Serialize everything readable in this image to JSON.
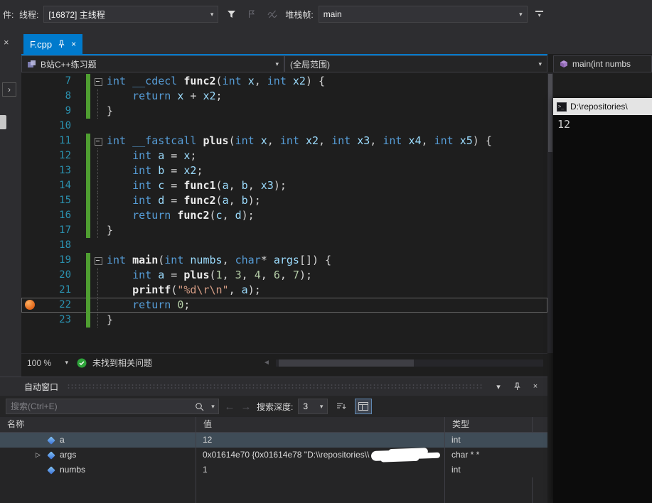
{
  "toolbar": {
    "partial": "件:",
    "thread_label": "线程:",
    "thread_value": "[16872] 主线程",
    "stack_label": "堆栈帧:",
    "stack_value": "main"
  },
  "tab": {
    "title": "F.cpp"
  },
  "navbar": {
    "project": "B站C++练习题",
    "scope": "(全局范围)",
    "member": "main(int numbs"
  },
  "editor": {
    "zoom": "100 %",
    "status_message": "未找到相关问题",
    "lines": [
      {
        "n": "7",
        "fold": "o",
        "chg": true,
        "seg": [
          [
            "k",
            "int "
          ],
          [
            "k",
            "__cdecl "
          ],
          [
            "f",
            "func2"
          ],
          [
            "p",
            "("
          ],
          [
            "k",
            "int "
          ],
          [
            "v",
            "x"
          ],
          [
            "p",
            ", "
          ],
          [
            "k",
            "int "
          ],
          [
            "v",
            "x2"
          ],
          [
            "p",
            ") {"
          ]
        ]
      },
      {
        "n": "8",
        "fold": "i",
        "chg": true,
        "seg": [
          [
            "p",
            "    "
          ],
          [
            "k",
            "return "
          ],
          [
            "v",
            "x"
          ],
          [
            "p",
            " + "
          ],
          [
            "v",
            "x2"
          ],
          [
            "p",
            ";"
          ]
        ]
      },
      {
        "n": "9",
        "fold": "i",
        "chg": true,
        "seg": [
          [
            "p",
            "}"
          ]
        ]
      },
      {
        "n": "10",
        "fold": "",
        "chg": false,
        "seg": []
      },
      {
        "n": "11",
        "fold": "o",
        "chg": true,
        "seg": [
          [
            "k",
            "int "
          ],
          [
            "k",
            "__fastcall "
          ],
          [
            "f",
            "plus"
          ],
          [
            "p",
            "("
          ],
          [
            "k",
            "int "
          ],
          [
            "v",
            "x"
          ],
          [
            "p",
            ", "
          ],
          [
            "k",
            "int "
          ],
          [
            "v",
            "x2"
          ],
          [
            "p",
            ", "
          ],
          [
            "k",
            "int "
          ],
          [
            "v",
            "x3"
          ],
          [
            "p",
            ", "
          ],
          [
            "k",
            "int "
          ],
          [
            "v",
            "x4"
          ],
          [
            "p",
            ", "
          ],
          [
            "k",
            "int "
          ],
          [
            "v",
            "x5"
          ],
          [
            "p",
            ") {"
          ]
        ]
      },
      {
        "n": "12",
        "fold": "i",
        "chg": true,
        "seg": [
          [
            "p",
            "    "
          ],
          [
            "k",
            "int "
          ],
          [
            "v",
            "a"
          ],
          [
            "p",
            " = "
          ],
          [
            "v",
            "x"
          ],
          [
            "p",
            ";"
          ]
        ]
      },
      {
        "n": "13",
        "fold": "i",
        "chg": true,
        "seg": [
          [
            "p",
            "    "
          ],
          [
            "k",
            "int "
          ],
          [
            "v",
            "b"
          ],
          [
            "p",
            " = "
          ],
          [
            "v",
            "x2"
          ],
          [
            "p",
            ";"
          ]
        ]
      },
      {
        "n": "14",
        "fold": "i",
        "chg": true,
        "seg": [
          [
            "p",
            "    "
          ],
          [
            "k",
            "int "
          ],
          [
            "v",
            "c"
          ],
          [
            "p",
            " = "
          ],
          [
            "f",
            "func1"
          ],
          [
            "p",
            "("
          ],
          [
            "v",
            "a"
          ],
          [
            "p",
            ", "
          ],
          [
            "v",
            "b"
          ],
          [
            "p",
            ", "
          ],
          [
            "v",
            "x3"
          ],
          [
            "p",
            ");"
          ]
        ]
      },
      {
        "n": "15",
        "fold": "i",
        "chg": true,
        "seg": [
          [
            "p",
            "    "
          ],
          [
            "k",
            "int "
          ],
          [
            "v",
            "d"
          ],
          [
            "p",
            " = "
          ],
          [
            "f",
            "func2"
          ],
          [
            "p",
            "("
          ],
          [
            "v",
            "a"
          ],
          [
            "p",
            ", "
          ],
          [
            "v",
            "b"
          ],
          [
            "p",
            ");"
          ]
        ]
      },
      {
        "n": "16",
        "fold": "i",
        "chg": true,
        "seg": [
          [
            "p",
            "    "
          ],
          [
            "k",
            "return "
          ],
          [
            "f",
            "func2"
          ],
          [
            "p",
            "("
          ],
          [
            "v",
            "c"
          ],
          [
            "p",
            ", "
          ],
          [
            "v",
            "d"
          ],
          [
            "p",
            ");"
          ]
        ]
      },
      {
        "n": "17",
        "fold": "i",
        "chg": true,
        "seg": [
          [
            "p",
            "}"
          ]
        ]
      },
      {
        "n": "18",
        "fold": "",
        "chg": false,
        "seg": []
      },
      {
        "n": "19",
        "fold": "o",
        "chg": true,
        "seg": [
          [
            "k",
            "int "
          ],
          [
            "f",
            "main"
          ],
          [
            "p",
            "("
          ],
          [
            "k",
            "int "
          ],
          [
            "v",
            "numbs"
          ],
          [
            "p",
            ", "
          ],
          [
            "k",
            "char"
          ],
          [
            "p",
            "* "
          ],
          [
            "v",
            "args"
          ],
          [
            "p",
            "[]) {"
          ]
        ]
      },
      {
        "n": "20",
        "fold": "i",
        "chg": true,
        "seg": [
          [
            "p",
            "    "
          ],
          [
            "k",
            "int "
          ],
          [
            "v",
            "a"
          ],
          [
            "p",
            " = "
          ],
          [
            "f",
            "plus"
          ],
          [
            "p",
            "("
          ],
          [
            "num",
            "1"
          ],
          [
            "p",
            ", "
          ],
          [
            "num",
            "3"
          ],
          [
            "p",
            ", "
          ],
          [
            "num",
            "4"
          ],
          [
            "p",
            ", "
          ],
          [
            "num",
            "6"
          ],
          [
            "p",
            ", "
          ],
          [
            "num",
            "7"
          ],
          [
            "p",
            ");"
          ]
        ]
      },
      {
        "n": "21",
        "fold": "i",
        "chg": true,
        "seg": [
          [
            "p",
            "    "
          ],
          [
            "f",
            "printf"
          ],
          [
            "p",
            "("
          ],
          [
            "s",
            "\"%d\\r\\n\""
          ],
          [
            "p",
            ", "
          ],
          [
            "v",
            "a"
          ],
          [
            "p",
            ");"
          ]
        ]
      },
      {
        "n": "22",
        "fold": "i",
        "chg": true,
        "cur": true,
        "bp": true,
        "seg": [
          [
            "p",
            "    "
          ],
          [
            "k",
            "return "
          ],
          [
            "num",
            "0"
          ],
          [
            "p",
            ";"
          ]
        ]
      },
      {
        "n": "23",
        "fold": "i",
        "chg": true,
        "seg": [
          [
            "p",
            "}"
          ]
        ]
      }
    ]
  },
  "console": {
    "title": "D:\\repositories\\",
    "output": "12"
  },
  "autos": {
    "title": "自动窗口",
    "search_placeholder": "搜索(Ctrl+E)",
    "depth_label": "搜索深度:",
    "depth_value": "3",
    "columns": [
      "名称",
      "值",
      "类型"
    ],
    "rows": [
      {
        "name": "a",
        "value": "12",
        "type": "int",
        "selected": true
      },
      {
        "name": "args",
        "value": "0x01614e70 {0x01614e78 \"D:\\\\repositories\\\\",
        "type": "char * *",
        "expandable": true,
        "censored": true
      },
      {
        "name": "numbs",
        "value": "1",
        "type": "int"
      }
    ]
  },
  "icons": {
    "chevron_down": "▾",
    "close": "×",
    "back": "←",
    "forward": "→",
    "scroll_left": "◄",
    "expander": "▷",
    "panel_chevron": "›"
  }
}
